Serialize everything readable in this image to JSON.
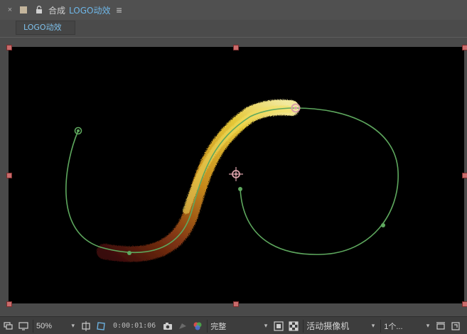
{
  "header": {
    "close_glyph": "×",
    "title_prefix": "合成",
    "title_name": "LOGO动效",
    "menu_glyph": "≡",
    "swatch_color": "#c4b59c"
  },
  "tabs": [
    {
      "label": "LOGO动效"
    }
  ],
  "toolbar": {
    "magnification": "50%",
    "timecode": "0:00:01:06",
    "resolution": "完整",
    "camera": "活动摄像机",
    "views": "1个..."
  },
  "colors": {
    "path_green": "#5ea85e",
    "anchor_pink": "#d9a0a8",
    "handle_red": "#c96b6b",
    "accent_blue": "#6fb7e8"
  },
  "icons": {
    "close": "close-icon",
    "lock": "lock-icon",
    "menu": "menu-icon",
    "snapshot": "camera-icon",
    "color_wheel": "color-channel-icon"
  }
}
